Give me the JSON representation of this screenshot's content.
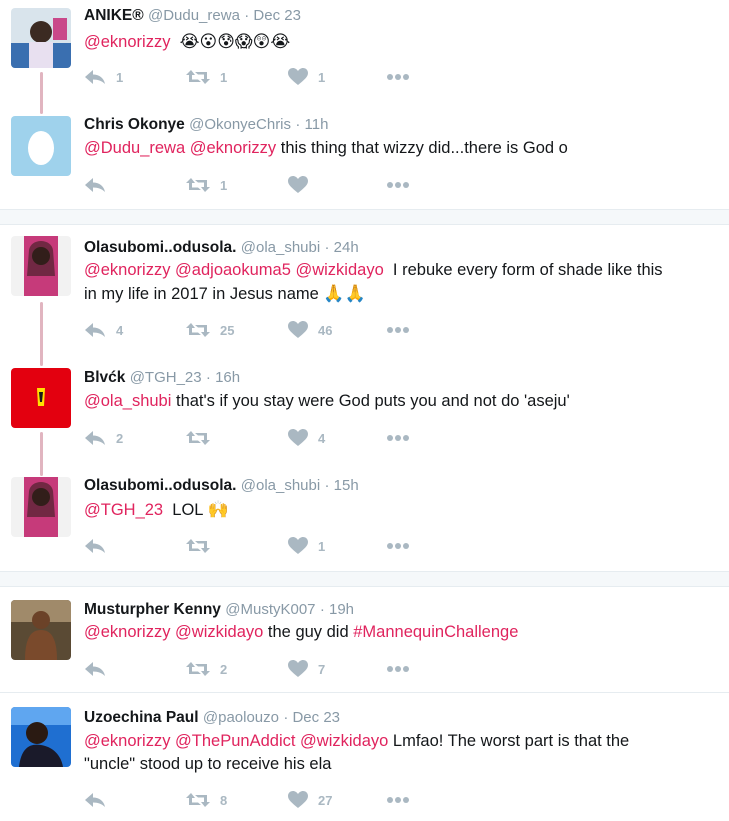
{
  "tweets": [
    {
      "name": "ANIKE®",
      "handle": "@Dudu_rewa",
      "time": "· Dec 23",
      "mentions": [
        "@eknorizzy"
      ],
      "text": "",
      "emoji": "😭😮😰😱😲😭",
      "replies": "1",
      "retweets": "1",
      "likes": "1"
    },
    {
      "name": "Chris Okonye",
      "handle": "@OkonyeChris",
      "time": "· 11h",
      "mentions": [
        "@Dudu_rewa",
        "@eknorizzy"
      ],
      "text": "this thing that wizzy did...there is God o",
      "replies": "",
      "retweets": "1",
      "likes": ""
    },
    {
      "name": "Olasubomi..odusola.",
      "handle": "@ola_shubi",
      "time": "· 24h",
      "mentions": [
        "@eknorizzy",
        "@adjoaokuma5",
        "@wizkidayo"
      ],
      "text": "I rebuke every form of shade  like this",
      "text2": "in my life in 2017 in Jesus name",
      "emoji": "🙏🙏",
      "replies": "4",
      "retweets": "25",
      "likes": "46"
    },
    {
      "name": "Blvćk",
      "handle": "@TGH_23",
      "time": "· 16h",
      "mentions": [
        "@ola_shubi"
      ],
      "text": "that's if you stay were God puts you and not do 'aseju'",
      "replies": "2",
      "retweets": "",
      "likes": "4"
    },
    {
      "name": "Olasubomi..odusola.",
      "handle": "@ola_shubi",
      "time": "· 15h",
      "mentions": [
        "@TGH_23"
      ],
      "text": "LOL",
      "emoji": "🙌",
      "replies": "",
      "retweets": "",
      "likes": "1"
    },
    {
      "name": "Musturpher Kenny",
      "handle": "@MustyK007",
      "time": "· 19h",
      "mentions": [
        "@eknorizzy",
        "@wizkidayo"
      ],
      "text": "the guy did",
      "hashtag": "#MannequinChallenge",
      "replies": "",
      "retweets": "2",
      "likes": "7"
    },
    {
      "name": "Uzoechina Paul",
      "handle": "@paolouzo",
      "time": "· Dec 23",
      "mentions": [
        "@eknorizzy",
        "@ThePunAddict",
        "@wizkidayo"
      ],
      "text": "Lmfao! The worst part is that the",
      "text2": "\"uncle\" stood up to receive his ela",
      "replies": "",
      "retweets": "8",
      "likes": "27"
    }
  ],
  "icons": {
    "reply": "reply-icon",
    "retweet": "retweet-icon",
    "like": "heart-icon",
    "more": "more-dots-icon"
  },
  "colors": {
    "mention": "#e0245e",
    "meta": "#8899a6",
    "action": "#aab8c2",
    "thread_line": "#e1b5c0",
    "separator": "#f5f8fa"
  }
}
